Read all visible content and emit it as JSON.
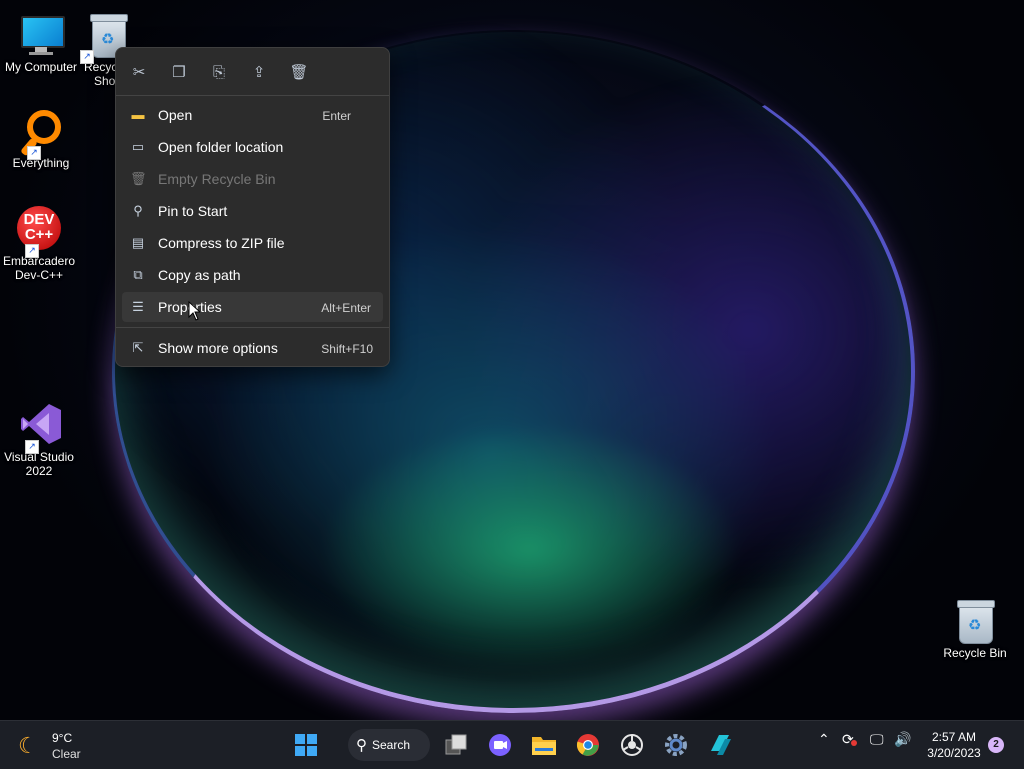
{
  "desktop": {
    "icons": [
      {
        "label": "My Computer",
        "icon": "computer-icon"
      },
      {
        "label": "Recyc",
        "label2": "Sho",
        "icon": "recycle-bin-icon",
        "shortcut": true
      },
      {
        "label": "Everything",
        "icon": "everything-icon",
        "shortcut": true
      },
      {
        "label": "Embarcadero",
        "label2": "Dev-C++",
        "icon": "devcpp-icon",
        "shortcut": true
      },
      {
        "label": "Visual Studio",
        "label2": "2022",
        "icon": "visual-studio-icon",
        "shortcut": true
      },
      {
        "label": "Recycle Bin",
        "icon": "recycle-bin-icon"
      }
    ],
    "devcpp_logo_text": "DEV\nC++"
  },
  "context_menu": {
    "toolbar": [
      {
        "name": "cut",
        "icon": "scissors-icon",
        "glyph": "✂"
      },
      {
        "name": "copy",
        "icon": "copy-icon",
        "glyph": "❐"
      },
      {
        "name": "rename",
        "icon": "rename-icon",
        "glyph": "⎘"
      },
      {
        "name": "share",
        "icon": "share-icon",
        "glyph": "⇪"
      },
      {
        "name": "delete",
        "icon": "trash-icon",
        "glyph": "🗑"
      }
    ],
    "items": [
      {
        "label": "Open",
        "shortcut": "Enter",
        "icon": "folder-yellow-icon",
        "glyph": "▬",
        "disabled": false
      },
      {
        "label": "Open folder location",
        "shortcut": "",
        "icon": "folder-outline-icon",
        "glyph": "▭",
        "disabled": false
      },
      {
        "label": "Empty Recycle Bin",
        "shortcut": "",
        "icon": "trash-icon",
        "glyph": "🗑",
        "disabled": true
      },
      {
        "label": "Pin to Start",
        "shortcut": "",
        "icon": "pin-icon",
        "glyph": "⚲",
        "disabled": false
      },
      {
        "label": "Compress to ZIP file",
        "shortcut": "",
        "icon": "zip-icon",
        "glyph": "▤",
        "disabled": false
      },
      {
        "label": "Copy as path",
        "shortcut": "",
        "icon": "copy-path-icon",
        "glyph": "⧉",
        "disabled": false
      },
      {
        "label": "Properties",
        "shortcut": "Alt+Enter",
        "icon": "properties-icon",
        "glyph": "☰",
        "disabled": false,
        "hover": true
      },
      {
        "label": "Show more options",
        "shortcut": "Shift+F10",
        "icon": "more-options-icon",
        "glyph": "⇱",
        "disabled": false
      }
    ]
  },
  "taskbar": {
    "weather": {
      "temp": "9°C",
      "condition": "Clear",
      "icon": "moon-icon"
    },
    "search_label": "Search",
    "apps": [
      "start-icon",
      "task-view-icon",
      "teams-chat-icon",
      "file-explorer-icon",
      "chrome-icon",
      "steam-icon",
      "settings-icon",
      "remote-icon"
    ],
    "tray": [
      "chevron-up-icon",
      "sync-icon",
      "network-icon",
      "volume-icon"
    ],
    "clock": {
      "time": "2:57 AM",
      "date": "3/20/2023"
    },
    "notification_count": "2"
  }
}
